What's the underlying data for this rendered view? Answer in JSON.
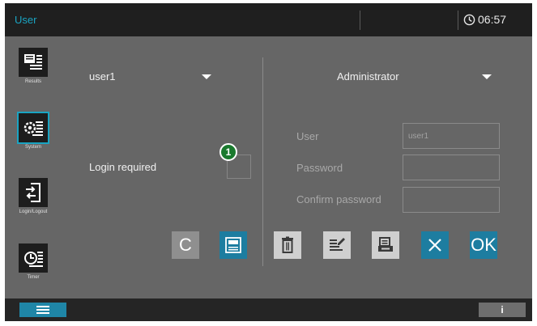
{
  "header": {
    "title": "User",
    "time": "06:57",
    "clock_icon": "clock-icon"
  },
  "nav": {
    "items": [
      {
        "label": "Results",
        "icon": "results-icon",
        "active": false
      },
      {
        "label": "System",
        "icon": "system-icon",
        "active": true
      },
      {
        "label": "Login/Logout",
        "icon": "login-logout-icon",
        "active": false
      },
      {
        "label": "Timer",
        "icon": "timer-icon",
        "active": false
      }
    ]
  },
  "left_panel": {
    "user_select": {
      "value": "user1"
    },
    "login_required": {
      "label": "Login required",
      "checked": false
    },
    "callout_number": "1"
  },
  "right_panel": {
    "role_select": {
      "value": "Administrator"
    },
    "fields": {
      "user": {
        "label": "User",
        "value": "user1"
      },
      "password": {
        "label": "Password",
        "value": ""
      },
      "confirm_password": {
        "label": "Confirm password",
        "value": ""
      }
    }
  },
  "toolbar": {
    "clear_label": "C",
    "ok_label": "OK",
    "buttons": [
      "clear",
      "save",
      "delete",
      "edit",
      "print",
      "cancel",
      "ok"
    ]
  },
  "bottombar": {
    "menu_icon": "menu-icon",
    "info_label": "i"
  },
  "colors": {
    "accent": "#1aa4c2",
    "button_teal": "#1d7da0",
    "callout_green": "#1a7a2e"
  }
}
